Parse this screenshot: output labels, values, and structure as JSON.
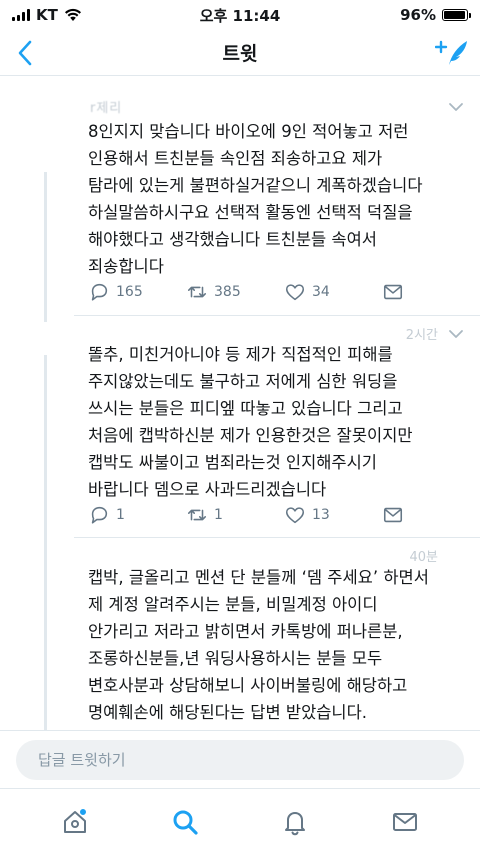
{
  "status_bar": {
    "carrier": "KT",
    "time": "오후 11:44",
    "battery_text": "96%",
    "battery_level": 0.96
  },
  "nav": {
    "title": "트윗",
    "back_icon": "chevron-left-icon",
    "compose_icon": "compose-tweet-icon"
  },
  "tweets": [
    {
      "header_name": "r제리",
      "header_time": "",
      "text": "8인지지 맞습니다 바이오에 9인 적어놓고 저런\n인용해서 트친분들 속인점 죄송하고요 제가\n탐라에 있는게 불편하실거같으니 계폭하겠습니다\n하실말씀하시구요 선택적 활동엔 선택적 덕질을\n해야했다고 생각했습니다 트친분들 속여서\n죄송합니다",
      "replies": "165",
      "retweets": "385",
      "likes": "34"
    },
    {
      "header_name": "",
      "header_time": "2시간",
      "text": "똘추, 미친거아니야 등 제가 직접적인 피해를\n주지않았는데도 불구하고 저에게 심한 워딩을\n쓰시는 분들은 피디엪 따놓고 있습니다 그리고\n처음에 캡박하신분 제가 인용한것은 잘못이지만\n캡박도 싸불이고 범죄라는것 인지해주시기\n바랍니다 뎀으로 사과드리겠습니다",
      "replies": "1",
      "retweets": "1",
      "likes": "13"
    },
    {
      "header_name": "",
      "header_time": "40분",
      "text": "캡박, 글올리고 멘션 단 분들께 ‘뎀 주세요’ 하면서\n제 계정 알려주시는 분들, 비밀계정 아이디\n안가리고 저라고 밝히면서 카톡방에 퍼나른분,\n조롱하신분들,년 워딩사용하시는 분들 모두\n변호사분과 상담해보니 사이버불링에 해당하고\n명예훼손에 해당된다는 답변 받았습니다."
    }
  ],
  "reply_bar": {
    "placeholder": "답글 트윗하기"
  },
  "tab_bar": {
    "items": [
      "home-icon",
      "search-icon",
      "notifications-icon",
      "messages-icon"
    ]
  },
  "colors": {
    "accent": "#1da1f2",
    "text": "#14171a",
    "muted": "#657786",
    "divider": "#e1e8ed"
  }
}
